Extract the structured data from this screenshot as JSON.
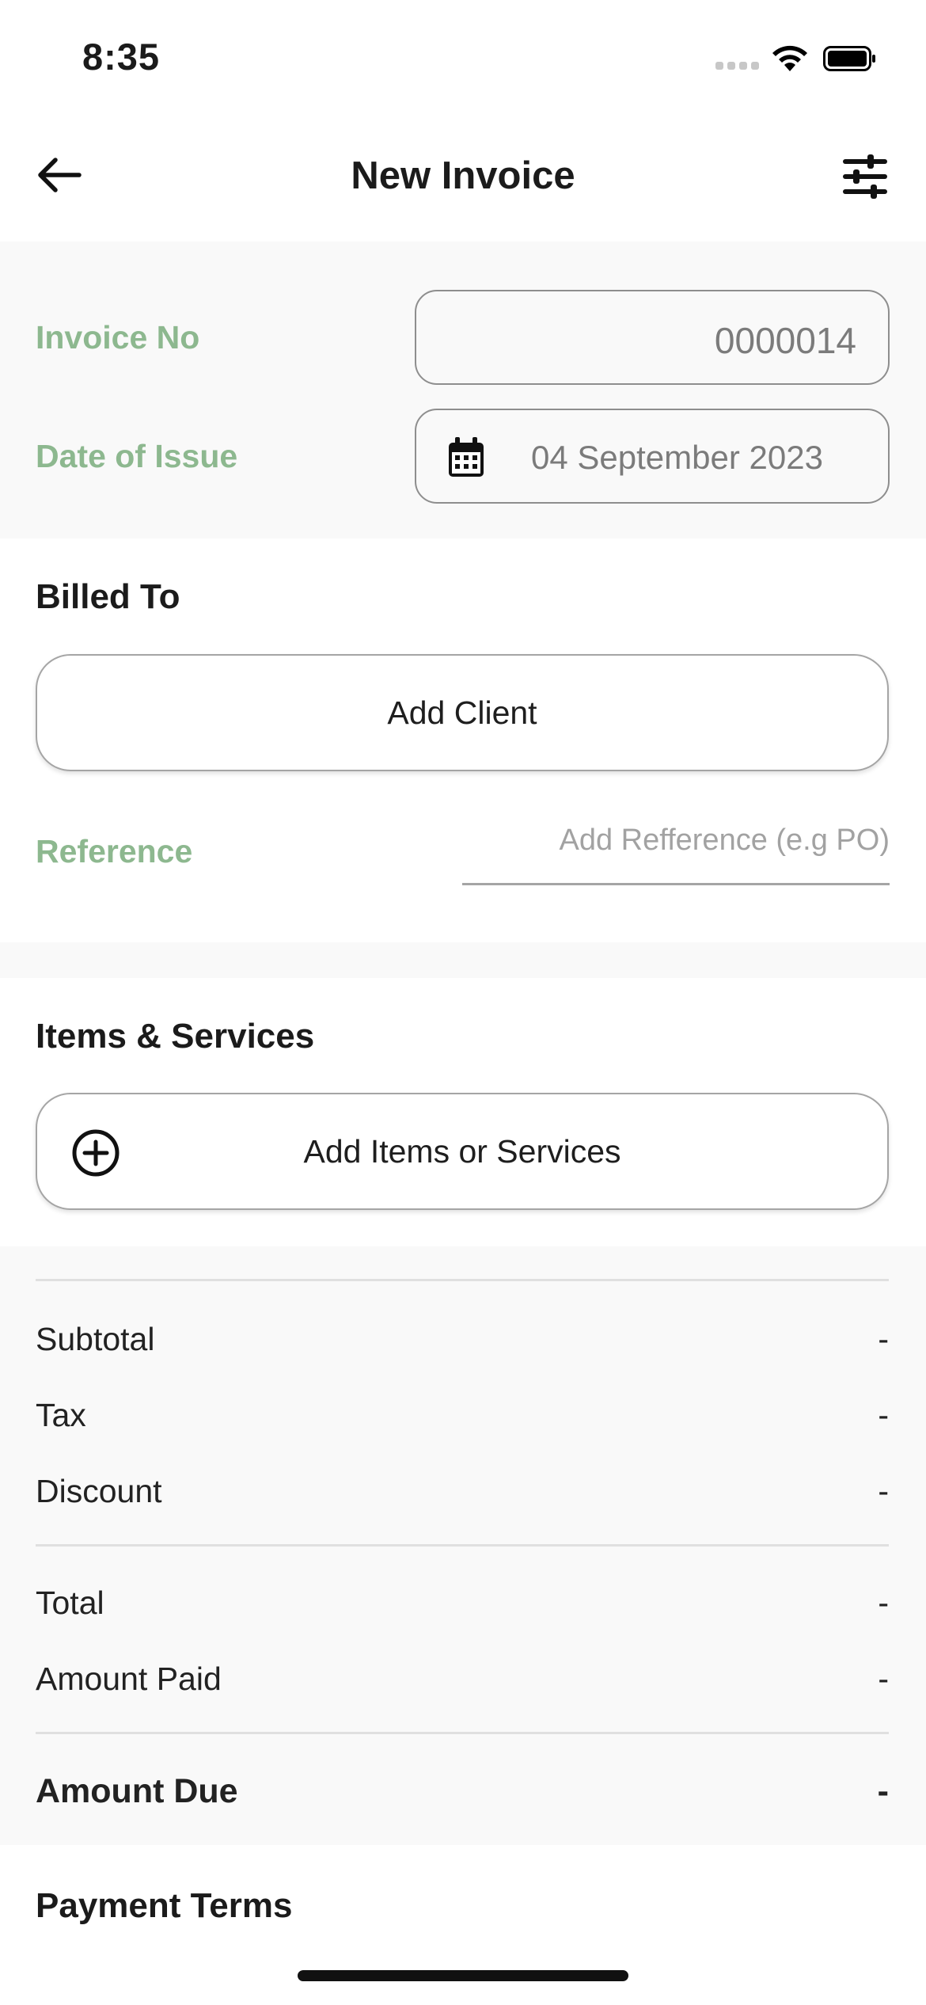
{
  "status_bar": {
    "time": "8:35"
  },
  "nav": {
    "title": "New Invoice"
  },
  "invoice": {
    "invoice_no_label": "Invoice No",
    "invoice_no_value": "0000014",
    "date_label": "Date of Issue",
    "date_value": "04 September 2023"
  },
  "billed_to": {
    "title": "Billed To",
    "add_client_label": "Add Client",
    "reference_label": "Reference",
    "reference_placeholder": "Add Refference (e.g PO)"
  },
  "items": {
    "title": "Items & Services",
    "add_items_label": "Add Items or Services"
  },
  "summary": {
    "subtotal_label": "Subtotal",
    "subtotal_value": "-",
    "tax_label": "Tax",
    "tax_value": "-",
    "discount_label": "Discount",
    "discount_value": "-",
    "total_label": "Total",
    "total_value": "-",
    "amount_paid_label": "Amount Paid",
    "amount_paid_value": "-",
    "amount_due_label": "Amount Due",
    "amount_due_value": "-"
  },
  "payment_terms": {
    "title": "Payment Terms"
  },
  "colors": {
    "accent_green": "#8db88f",
    "section_bg": "#f9f9f9"
  }
}
